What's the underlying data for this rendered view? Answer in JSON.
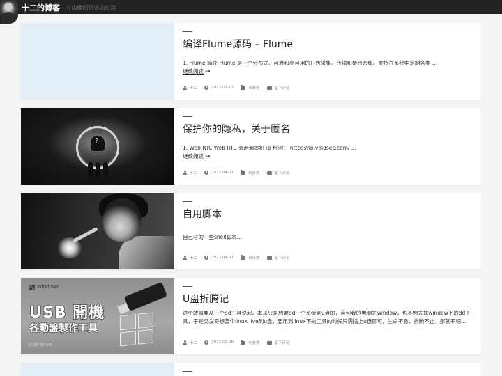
{
  "site": {
    "title": "十二的博客",
    "description": "— 在山腰间眺逃的红路"
  },
  "posts": [
    {
      "title": "编译Flume源码 – Flume",
      "excerpt": "1. Flume 简介 Flume 是一个分布式、可靠和高可用的日志采集、传输和聚合系统。支持在系统中定制各类 …",
      "read_more": "继续阅读",
      "arrow": "→",
      "author": "十二",
      "date": "2023-01-17",
      "category": "未分类",
      "comments": "留下评论",
      "thumb": "blank"
    },
    {
      "title": "保护你的隐私，关于匿名",
      "excerpt": "1. Web RTC Web RTC 会泄漏本机 ip 检测： https://ip.voidsec.com/ …",
      "read_more": "继续阅读",
      "arrow": "→",
      "author": "十二",
      "date": "2022-04-07",
      "category": "未分类",
      "comments": "留下评论",
      "thumb": "anonymous"
    },
    {
      "title": "自用脚本",
      "excerpt": "自己写的一些shell脚本…",
      "read_more": "",
      "arrow": "",
      "author": "十二",
      "date": "2022-04-01",
      "category": "未分类",
      "comments": "留下评论",
      "thumb": "singer"
    },
    {
      "title": "U盘折腾记",
      "excerpt": "这个故事要从一个dd工具说起。本来只是想要dd一个系统到u盘的，奈何我的电脑为window，也不想去找window下的dd工具，于是突发奇想装个linux live到u盘，要用到linux下的工具的时候只需插上u盘即可。生命不息，折腾不止，那就干吧…",
      "read_more": "",
      "arrow": "",
      "author": "十二",
      "date": "2022-02-09",
      "category": "未分类",
      "comments": "留下评论",
      "thumb": "usb",
      "thumb_text": {
        "windows": "Windows",
        "big": "USB 開機",
        "sub": "各動盤製作工具",
        "foot": "USB      drive"
      }
    }
  ]
}
